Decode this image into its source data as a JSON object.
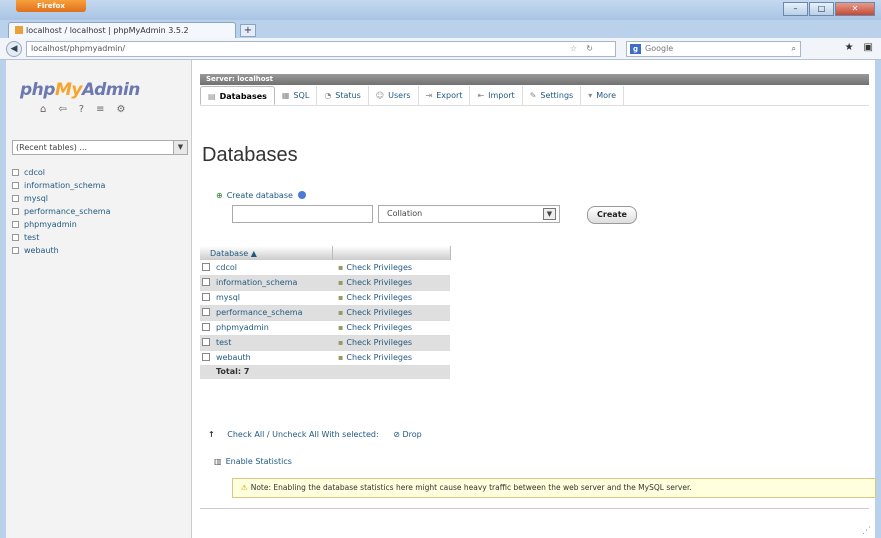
{
  "browser": {
    "app_button": "Firefox",
    "tab_title": "localhost / localhost | phpMyAdmin 3.5.2",
    "new_tab": "+",
    "url": "localhost/phpmyadmin/",
    "search_placeholder": "Google",
    "search_engine_glyph": "g",
    "window_controls": [
      "–",
      "□",
      "✕"
    ]
  },
  "sidebar": {
    "logo_php": "php",
    "logo_my": "My",
    "logo_admin": "Admin",
    "db_select_placeholder": "(Recent tables) ...",
    "databases": [
      "cdcol",
      "information_schema",
      "mysql",
      "performance_schema",
      "phpmyadmin",
      "test",
      "webauth"
    ]
  },
  "main": {
    "server_label": "Server: localhost",
    "tabs": [
      {
        "label": "Databases",
        "icon": "▤"
      },
      {
        "label": "SQL",
        "icon": "▦"
      },
      {
        "label": "Status",
        "icon": "◔"
      },
      {
        "label": "Users",
        "icon": "☺"
      },
      {
        "label": "Export",
        "icon": "⇥"
      },
      {
        "label": "Import",
        "icon": "⇤"
      },
      {
        "label": "Settings",
        "icon": "✎"
      },
      {
        "label": "More",
        "icon": "▾"
      }
    ],
    "page_title": "Databases",
    "create_label": "Create database",
    "collation_value": "Collation",
    "create_button": "Create",
    "table_header": {
      "database": "Database",
      "sort_icon": "▲",
      "privileges": ""
    },
    "rows": [
      {
        "name": "cdcol",
        "privileges": "Check Privileges"
      },
      {
        "name": "information_schema",
        "privileges": "Check Privileges"
      },
      {
        "name": "mysql",
        "privileges": "Check Privileges"
      },
      {
        "name": "performance_schema",
        "privileges": "Check Privileges"
      },
      {
        "name": "phpmyadmin",
        "privileges": "Check Privileges"
      },
      {
        "name": "test",
        "privileges": "Check Privileges"
      },
      {
        "name": "webauth",
        "privileges": "Check Privileges"
      }
    ],
    "total_label": "Total: 7",
    "check_all": "Check All / Uncheck All",
    "with_selected": "With selected:",
    "drop_label": "Drop",
    "enable_stats": "Enable Statistics",
    "notice": "Note: Enabling the database statistics here might cause heavy traffic between the web server and the MySQL server."
  }
}
